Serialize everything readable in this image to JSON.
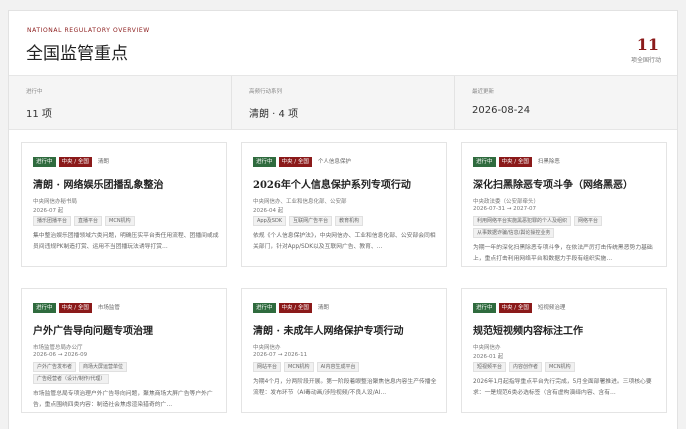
{
  "header": {
    "eyebrow": "NATIONAL REGULATORY OVERVIEW",
    "title": "全国监管重点",
    "count": "11",
    "count_label": "项全国行动"
  },
  "stats": [
    {
      "label": "进行中",
      "value": "11 项"
    },
    {
      "label": "高频行动系列",
      "value": "清朗 · 4 项"
    },
    {
      "label": "最近更新",
      "value": "2026-08-24"
    }
  ],
  "cards": [
    {
      "tags": [
        "进行中",
        "中央 / 全国",
        "清朗"
      ],
      "title": "清朗 · 网络娱乐团播乱象整治",
      "meta": [
        "中央网信办秘书局",
        "2026-07 起"
      ],
      "chips": [
        [
          "播乐团播平台",
          "直播平台",
          "MCN机构"
        ]
      ],
      "desc": "集中整治娱乐团播领域六类问题，明确压实平台责任用流程、团播间或成员间违规PK制造打赏、运用不当团播玩法诱导打赏…"
    },
    {
      "tags": [
        "进行中",
        "中央 / 全国",
        "个人信息保护"
      ],
      "title": "2026年个人信息保护系列专项行动",
      "meta": [
        "中央网信办、工业和信息化部、公安部",
        "2026-04 起"
      ],
      "chips": [
        [
          "App及SDK",
          "互联网广告平台",
          "教育机构"
        ]
      ],
      "desc": "依规《个人信息保护法》，中央网信办、工业和信息化部、公安部会同相关部门，针对App/SDK以及互联网广告、教育、…"
    },
    {
      "tags": [
        "进行中",
        "中央 / 全国",
        "扫黑除恶"
      ],
      "title": "深化扫黑除恶专项斗争（网络黑恶）",
      "meta": [
        "中央政法委（公安部牵头）",
        "2026-07-31 → 2027-07"
      ],
      "chips": [
        [
          "利用网络平台实施黑恶犯罪的个人及组织",
          "网络平台"
        ],
        [
          "从事数据诈骗/信息/舆论操控业务"
        ]
      ],
      "desc": "为期一年的深化扫黑除恶专项斗争，在依法严厉打击传统黑恶势力基础上，重点打击利用网络平台和数据力手段有组织实施…"
    },
    {
      "tags": [
        "进行中",
        "中央 / 全国",
        "市场监管"
      ],
      "title": "户外广告导向问题专项治理",
      "meta": [
        "市场监管总局办公厅",
        "2026-06 → 2026-09"
      ],
      "chips": [
        [
          "户外广告发布者",
          "商场大屏运营单位"
        ],
        [
          "广告经营者（设计/制作/代理）"
        ]
      ],
      "desc": "市场监管总局专项治理户外广告导向问题，聚焦商场大屏广告等户外广告，重点围绕四类内容：制造社会焦虑渲染猎奇的广…"
    },
    {
      "tags": [
        "进行中",
        "中央 / 全国",
        "清朗"
      ],
      "title": "清朗 · 未成年人网络保护专项行动",
      "meta": [
        "中央网信办",
        "2026-07 → 2026-11"
      ],
      "chips": [
        [
          "网站平台",
          "MCN机构",
          "AI内容生成平台"
        ]
      ],
      "desc": "为期4个月，分两阶段开展。第一阶段着眼整治聚焦信息内容生产传播全流程：发布环节（AI毒动画/涉险视频/不良人设/AI…"
    },
    {
      "tags": [
        "进行中",
        "中央 / 全国",
        "短视频治理"
      ],
      "title": "规范短视频内容标注工作",
      "meta": [
        "中央网信办",
        "2026-01 起"
      ],
      "chips": [
        [
          "短视频平台",
          "内容创作者",
          "MCN机构"
        ]
      ],
      "desc": "2026年1月起指导重点平台先行完成，5月全面部署推进。三项核心要求：一是规范6类必选标签（含有虚构演绎内容、含有…"
    }
  ]
}
